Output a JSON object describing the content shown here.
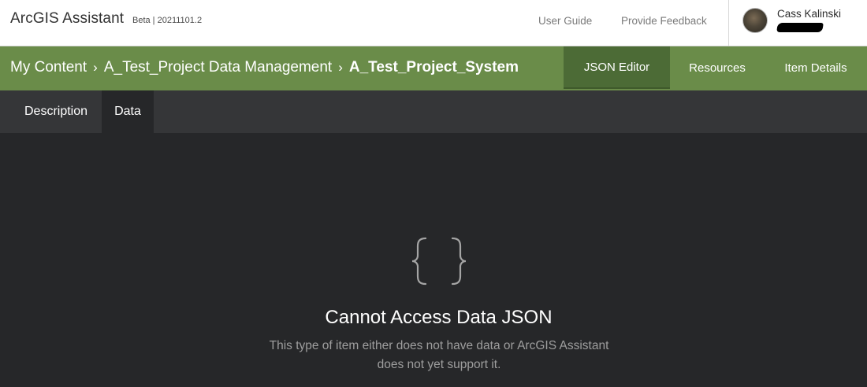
{
  "header": {
    "app_title": "ArcGIS Assistant",
    "version": "Beta | 20211101.2",
    "links": {
      "user_guide": "User Guide",
      "feedback": "Provide Feedback"
    },
    "user": {
      "name": "Cass Kalinski"
    }
  },
  "breadcrumb": {
    "items": [
      "My Content",
      "A_Test_Project Data Management",
      "A_Test_Project_System"
    ],
    "separator": "›"
  },
  "nav_tabs": {
    "json_editor": "JSON Editor",
    "resources": "Resources",
    "item_details": "Item Details",
    "active": "JSON Editor"
  },
  "sub_tabs": {
    "description": "Description",
    "data": "Data",
    "active": "Data"
  },
  "empty_state": {
    "icon": "curly-braces-icon",
    "title": "Cannot Access Data JSON",
    "message": "This type of item either does not have data or ArcGIS Assistant does not yet support it."
  },
  "colors": {
    "header_bg": "#ffffff",
    "nav_green": "#6a8c49",
    "nav_active": "#4c6b36",
    "subbar_bg": "#353638",
    "content_bg": "#262729"
  }
}
